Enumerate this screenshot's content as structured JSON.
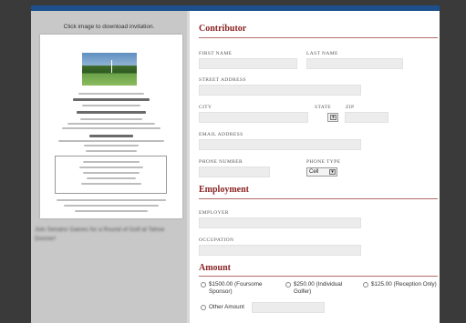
{
  "invitation": {
    "caption": "Click image to download invitation.",
    "blurb": "Join Senator Gaines for a Round of Golf at Tahoe Donner!"
  },
  "contributor": {
    "title": "Contributor",
    "first_name_label": "FIRST NAME",
    "last_name_label": "LAST NAME",
    "street_label": "STREET ADDRESS",
    "city_label": "CITY",
    "state_label": "STATE",
    "zip_label": "ZIP",
    "email_label": "EMAIL ADDRESS",
    "phone_label": "PHONE NUMBER",
    "phone_type_label": "PHONE TYPE",
    "phone_type_value": "Cell"
  },
  "employment": {
    "title": "Employment",
    "employer_label": "EMPLOYER",
    "occupation_label": "OCCUPATION"
  },
  "amount": {
    "title": "Amount",
    "options": [
      "$1500.00 (Foursome Sponsor)",
      "$250.00 (Individual Golfer)",
      "$125.00 (Reception Only)"
    ],
    "other_label": "Other Amount"
  },
  "colors": {
    "accent": "#8b2323",
    "topbar": "#1d4f8c"
  }
}
